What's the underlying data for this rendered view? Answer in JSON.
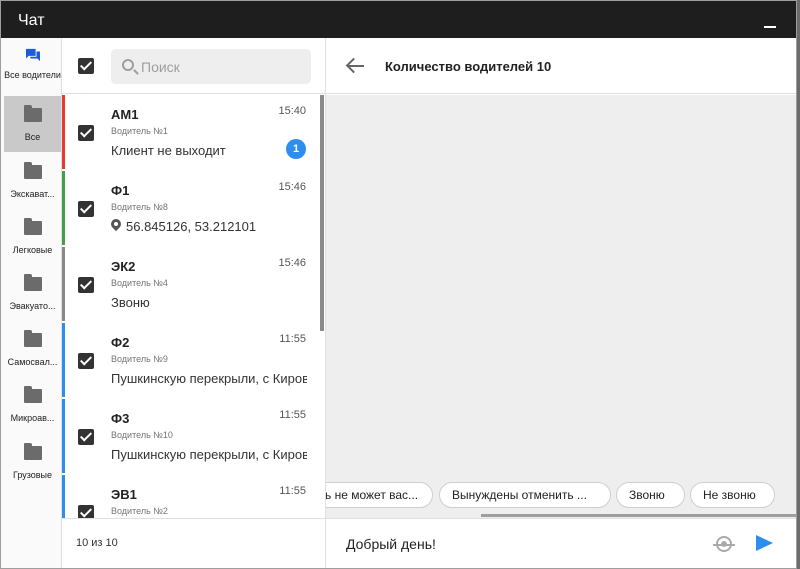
{
  "window": {
    "title": "Чат"
  },
  "rail": [
    {
      "label": "Все водители",
      "icon": "chat-icon",
      "active": false
    },
    {
      "label": "Все",
      "icon": "folder-icon",
      "active": true
    },
    {
      "label": "Экскават...",
      "icon": "folder-icon",
      "active": false
    },
    {
      "label": "Легковые",
      "icon": "folder-icon",
      "active": false
    },
    {
      "label": "Эвакуато...",
      "icon": "folder-icon",
      "active": false
    },
    {
      "label": "Самосвал...",
      "icon": "folder-icon",
      "active": false
    },
    {
      "label": "Микроав...",
      "icon": "folder-icon",
      "active": false
    },
    {
      "label": "Грузовые",
      "icon": "folder-icon",
      "active": false
    }
  ],
  "search": {
    "placeholder": "Поиск",
    "value": ""
  },
  "chats": [
    {
      "name": "АМ1",
      "driver": "Водитель №1",
      "message": "Клиент не выходит",
      "time": "15:40",
      "unread": "1",
      "color": "#e53935",
      "has_location": false
    },
    {
      "name": "Ф1",
      "driver": "Водитель №8",
      "message": "56.845126, 53.212101",
      "time": "15:46",
      "unread": "",
      "color": "#43a047",
      "has_location": true
    },
    {
      "name": "ЭК2",
      "driver": "Водитель №4",
      "message": "Звоню",
      "time": "15:46",
      "unread": "",
      "color": "#8a8a8a",
      "has_location": false
    },
    {
      "name": "Ф2",
      "driver": "Водитель №9",
      "message": "Пушкинскую перекрыли, с Кировской",
      "time": "11:55",
      "unread": "",
      "color": "#2d8ef0",
      "has_location": false
    },
    {
      "name": "Ф3",
      "driver": "Водитель №10",
      "message": "Пушкинскую перекрыли, с Кировской",
      "time": "11:55",
      "unread": "",
      "color": "#2d8ef0",
      "has_location": false
    },
    {
      "name": "ЭВ1",
      "driver": "Водитель №2",
      "message": "",
      "time": "11:55",
      "unread": "",
      "color": "#2d8ef0",
      "has_location": false
    }
  ],
  "footer": {
    "count": "10 из 10"
  },
  "conversation": {
    "title": "Количество водителей 10",
    "quick_replies": [
      "ь не может вас...",
      "Вынуждены отменить ...",
      "Звоню",
      "Не звоню"
    ],
    "input_value": "Добрый день!"
  },
  "colors": {
    "accent": "#2d8ef0",
    "titlebar": "#1e1e1e"
  }
}
